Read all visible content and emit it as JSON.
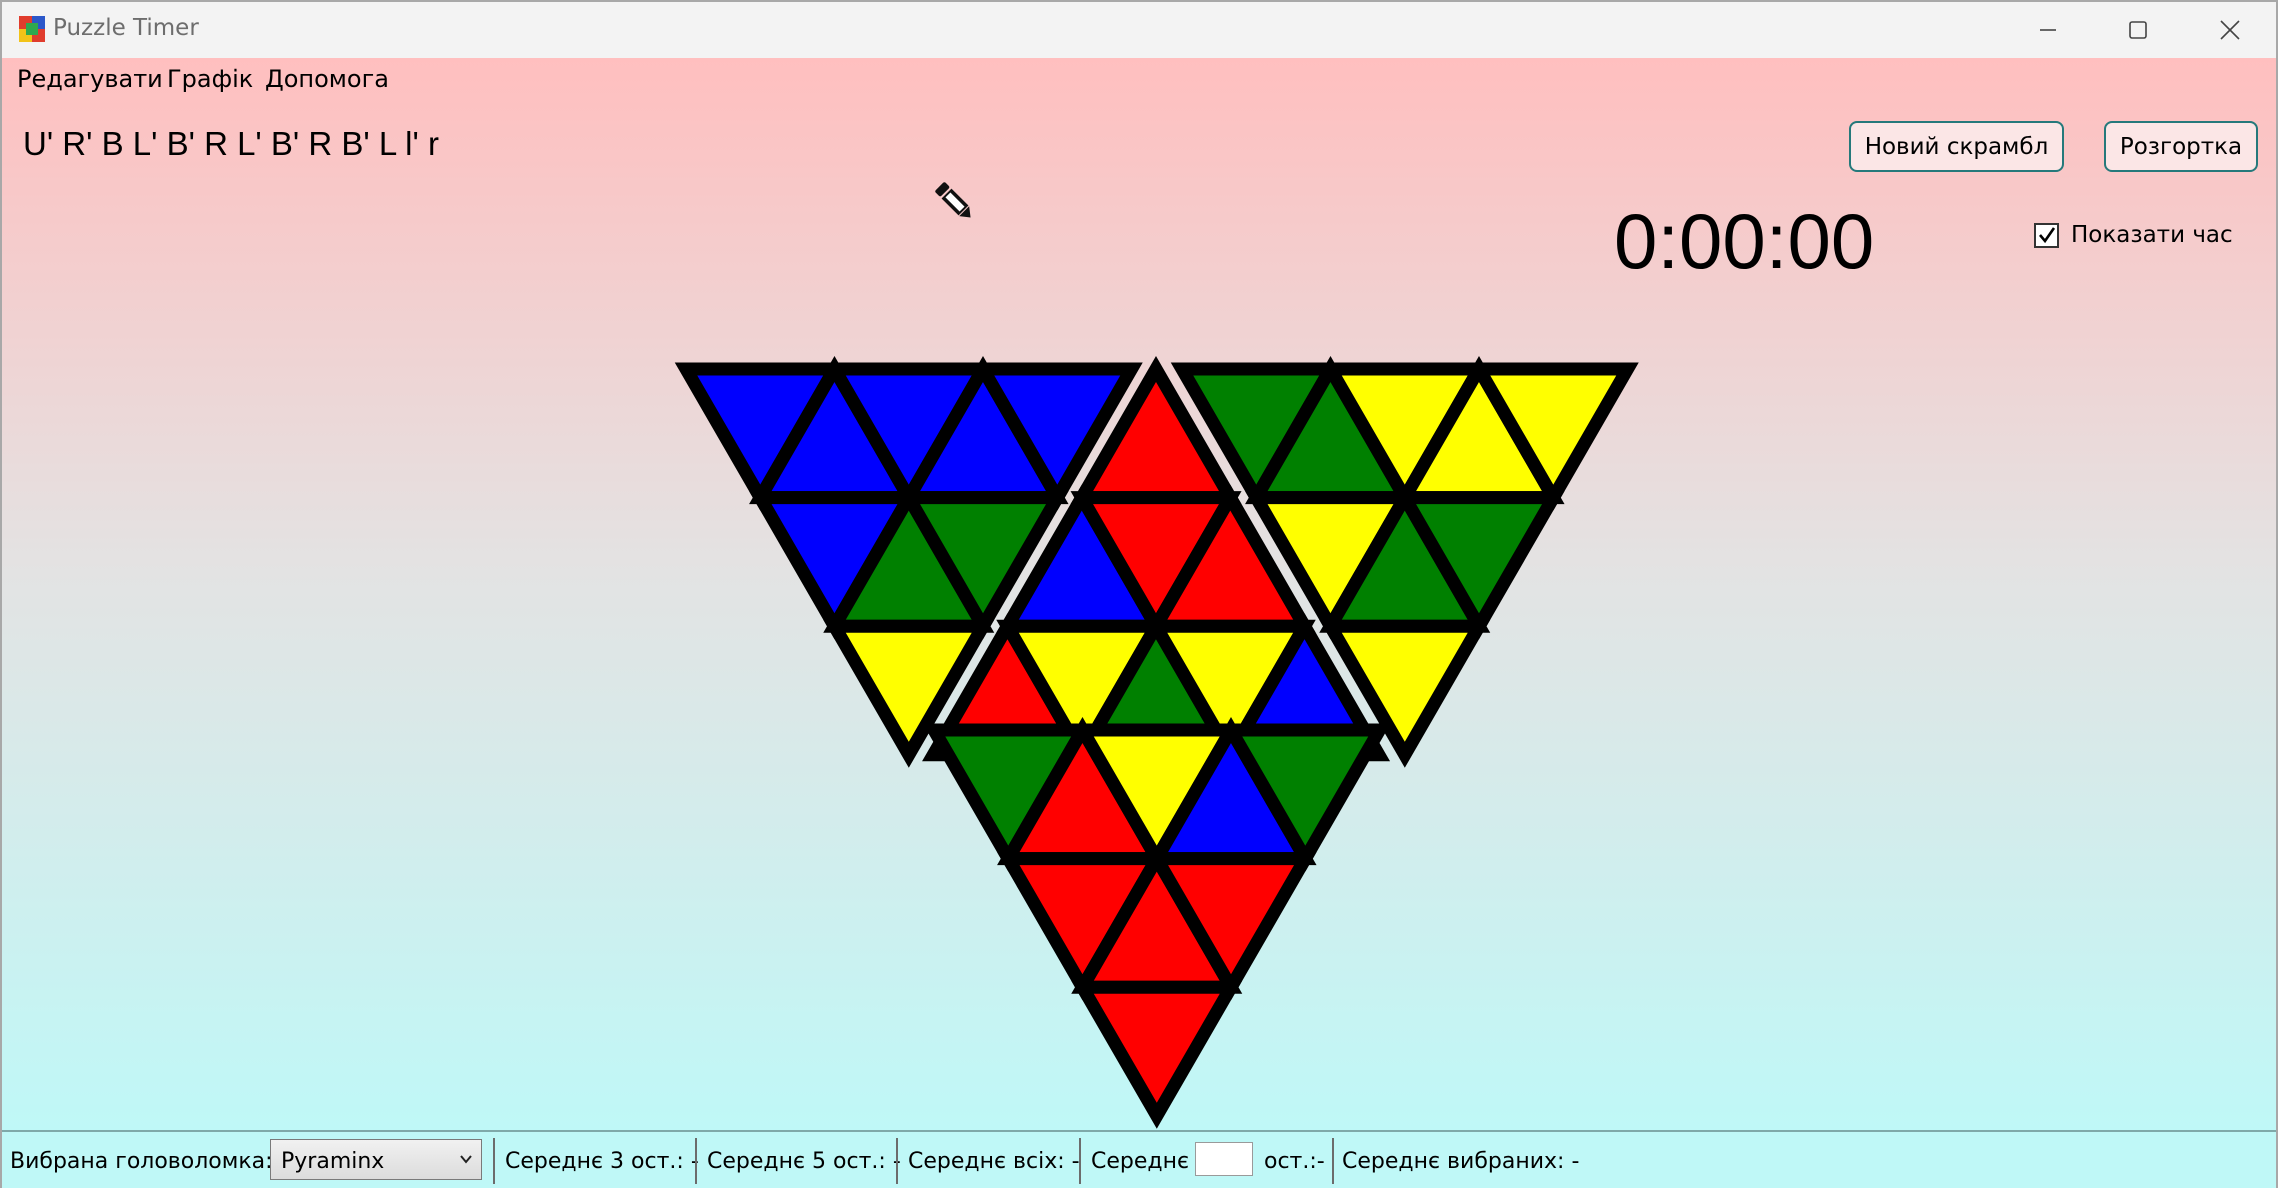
{
  "window": {
    "title": "Puzzle Timer",
    "icon": "app-icon"
  },
  "menu": {
    "edit": "Редагувати",
    "graph": "Графік",
    "help": "Допомога"
  },
  "scramble": "U' R' B L' B' R L' B' R B' L l' r",
  "buttons": {
    "new_scramble": "Новий скрамбл",
    "net": "Розгортка"
  },
  "timer": "0:00:00",
  "show_time": {
    "label": "Показати час",
    "checked": true
  },
  "colors": {
    "blue": "#0000ff",
    "green": "#008000",
    "yellow": "#ffff00",
    "red": "#ff0000"
  },
  "puzzle_net": {
    "faces": [
      {
        "name": "left",
        "stickers": [
          "blue",
          "blue",
          "blue",
          "blue",
          "blue",
          "blue",
          "green",
          "green",
          "yellow"
        ]
      },
      {
        "name": "front",
        "stickers": [
          "red",
          "blue",
          "red",
          "red",
          "red",
          "yellow",
          "green",
          "yellow",
          "blue"
        ]
      },
      {
        "name": "right",
        "stickers": [
          "green",
          "green",
          "yellow",
          "yellow",
          "yellow",
          "yellow",
          "green",
          "green",
          "yellow"
        ]
      },
      {
        "name": "bottom",
        "stickers": [
          "green",
          "red",
          "yellow",
          "blue",
          "green",
          "red",
          "red",
          "red",
          "red"
        ]
      }
    ]
  },
  "status": {
    "selected_puzzle_label": "Вибрана головоломка:",
    "selected_puzzle_value": "Pyraminx",
    "avg3": "Середнє 3 ост.: -",
    "avg5": "Середнє 5 ост.: -",
    "avg_all": "Середнє всіх: -",
    "avg_custom_prefix": "Середнє",
    "avg_custom_input": "",
    "avg_custom_suffix": "ост.:-",
    "avg_selected": "Середнє  вибраних:  -"
  }
}
